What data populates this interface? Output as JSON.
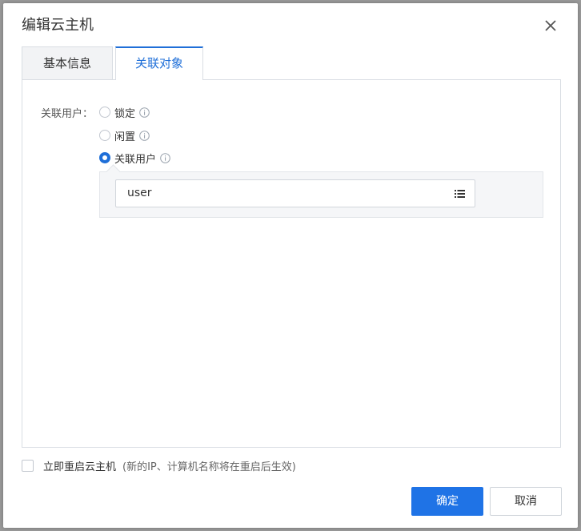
{
  "dialog": {
    "title": "编辑云主机"
  },
  "tabs": [
    {
      "label": "基本信息",
      "active": false
    },
    {
      "label": "关联对象",
      "active": true
    }
  ],
  "assoc": {
    "field_label": "关联用户：",
    "options": [
      {
        "label": "锁定",
        "selected": false
      },
      {
        "label": "闲置",
        "selected": false
      },
      {
        "label": "关联用户",
        "selected": true
      }
    ],
    "user_value": "user"
  },
  "restart": {
    "label": "立即重启云主机",
    "hint": "(新的IP、计算机名称将在重启后生效)",
    "checked": false
  },
  "buttons": {
    "ok_label": "确定",
    "cancel_label": "取消"
  },
  "colors": {
    "accent": "#1f73e6",
    "tab_active": "#1f6fd8"
  }
}
